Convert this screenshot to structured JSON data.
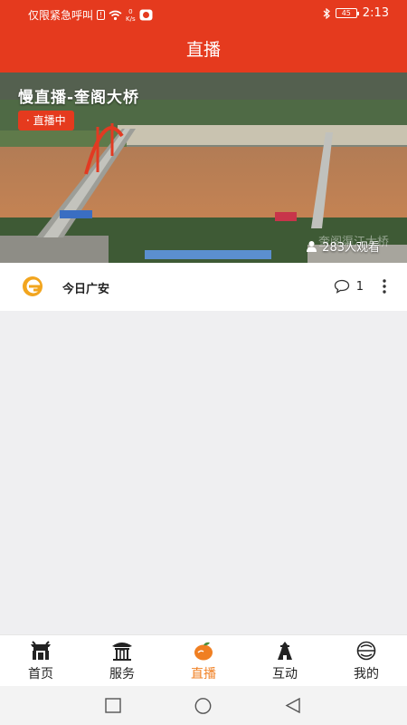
{
  "status_bar": {
    "carrier_text": "仅限紧急呼叫",
    "sim_label": "!",
    "speed_value": "0",
    "speed_unit": "K/s",
    "battery_level": "45",
    "time": "2:13"
  },
  "header": {
    "title": "直播"
  },
  "live": {
    "title": "慢直播-奎阁大桥",
    "badge": "· 直播中",
    "viewers": "283人观看",
    "watermark": "奎阁渠江大桥"
  },
  "source": {
    "name": "今日广安",
    "comment_count": "1"
  },
  "tabs": [
    {
      "label": "首页",
      "icon": "home-gate-icon"
    },
    {
      "label": "服务",
      "icon": "pavilion-icon"
    },
    {
      "label": "直播",
      "icon": "live-orange-icon",
      "active": true
    },
    {
      "label": "互动",
      "icon": "tower-icon"
    },
    {
      "label": "我的",
      "icon": "profile-circle-icon"
    }
  ],
  "colors": {
    "brand_red": "#e53a1e",
    "active_orange": "#f07f22"
  }
}
